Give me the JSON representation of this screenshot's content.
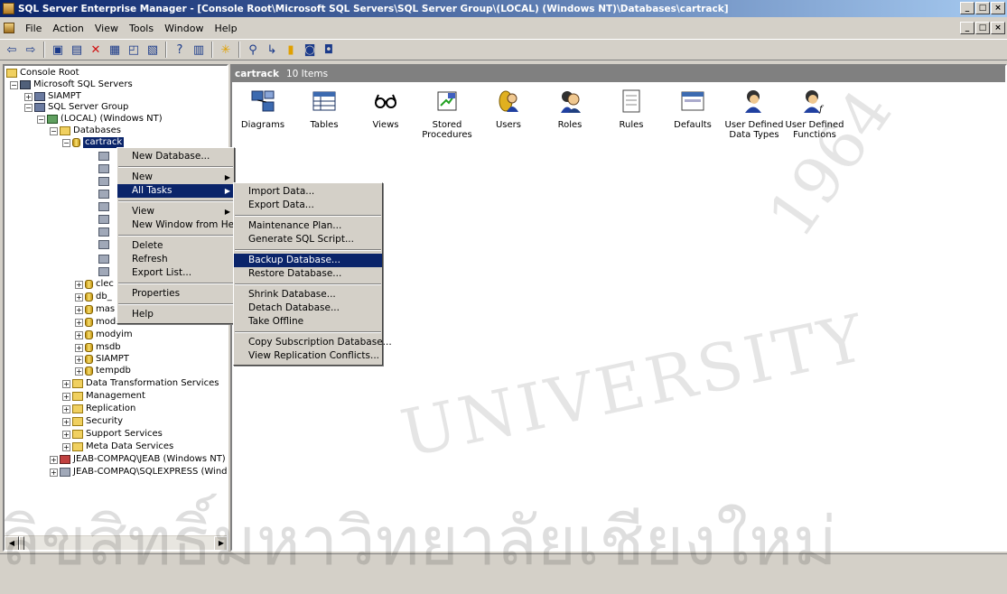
{
  "window": {
    "title": "SQL Server Enterprise Manager - [Console Root\\Microsoft SQL Servers\\SQL Server Group\\(LOCAL) (Windows NT)\\Databases\\cartrack]"
  },
  "menubar": [
    "File",
    "Action",
    "View",
    "Tools",
    "Window",
    "Help"
  ],
  "tree": {
    "console_root": "Console Root",
    "ms_sql_servers": "Microsoft SQL Servers",
    "siampt_server": "SIAMPT",
    "sql_server_group": "SQL Server Group",
    "local": "(LOCAL) (Windows NT)",
    "databases": "Databases",
    "cartrack": "cartrack",
    "partial_dbs": [
      "clec",
      "db_",
      "mas",
      "model"
    ],
    "dbs": [
      "modyim",
      "msdb",
      "SIAMPT",
      "tempdb"
    ],
    "folders": [
      "Data Transformation Services",
      "Management",
      "Replication",
      "Security",
      "Support Services",
      "Meta Data Services"
    ],
    "servers": [
      "JEAB-COMPAQ\\JEAB (Windows NT)",
      "JEAB-COMPAQ\\SQLEXPRESS (Windows N"
    ]
  },
  "right_pane": {
    "title": "cartrack",
    "count": "10 Items",
    "items": [
      {
        "label": "Diagrams",
        "icon": "diagram-icon"
      },
      {
        "label": "Tables",
        "icon": "table-icon"
      },
      {
        "label": "Views",
        "icon": "glasses-icon"
      },
      {
        "label": "Stored Procedures",
        "icon": "procedure-icon"
      },
      {
        "label": "Users",
        "icon": "user-icon"
      },
      {
        "label": "Roles",
        "icon": "roles-icon"
      },
      {
        "label": "Rules",
        "icon": "rules-icon"
      },
      {
        "label": "Defaults",
        "icon": "defaults-icon"
      },
      {
        "label": "User Defined Data Types",
        "icon": "udt-icon"
      },
      {
        "label": "User Defined Functions",
        "icon": "udf-icon"
      }
    ]
  },
  "context_menu": {
    "items": [
      "New Database...",
      "New",
      "All Tasks",
      "View",
      "New Window from Here",
      "Delete",
      "Refresh",
      "Export List...",
      "Properties",
      "Help"
    ]
  },
  "submenu": {
    "items": [
      "Import Data...",
      "Export Data...",
      "Maintenance Plan...",
      "Generate SQL Script...",
      "Backup Database...",
      "Restore Database...",
      "Shrink Database...",
      "Detach Database...",
      "Take Offline",
      "Copy Subscription Database...",
      "View Replication Conflicts..."
    ]
  },
  "watermark": {
    "english": "UNIVERSITY",
    "thai": "ลิขสิทธิ์มหาวิทยาลัยเชียงใหม่",
    "year": "1964"
  },
  "colors": {
    "title_start": "#0a246a",
    "title_end": "#a6caf0",
    "selection": "#0a246a",
    "pane_header": "#808080"
  }
}
